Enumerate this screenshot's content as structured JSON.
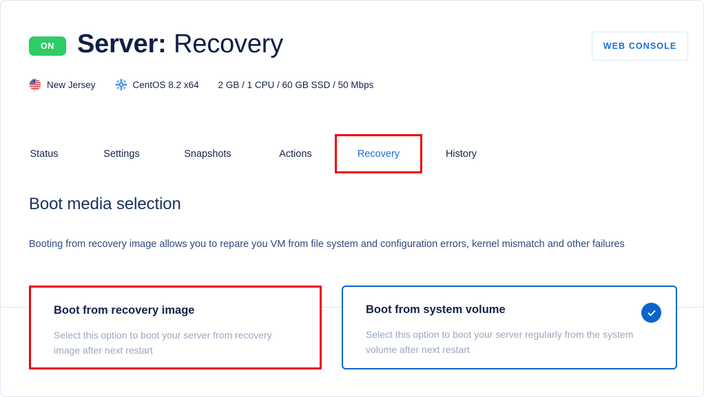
{
  "header": {
    "status_badge": "ON",
    "title_prefix": "Server:",
    "title_name": "Recovery",
    "web_console_label": "WEB CONSOLE",
    "meta": [
      {
        "icon": "us-flag-icon",
        "label": "New Jersey"
      },
      {
        "icon": "centos-logo-icon",
        "label": "CentOS 8.2 x64"
      },
      {
        "icon": "",
        "label": "2 GB / 1 CPU / 60 GB SSD / 50 Mbps"
      }
    ]
  },
  "tabs": [
    {
      "label": "Status",
      "active": false
    },
    {
      "label": "Settings",
      "active": false
    },
    {
      "label": "Snapshots",
      "active": false
    },
    {
      "label": "Actions",
      "active": false
    },
    {
      "label": "Recovery",
      "active": true
    },
    {
      "label": "History",
      "active": false
    }
  ],
  "main": {
    "section_title": "Boot media selection",
    "section_description": "Booting from recovery image allows you to repare you VM from file system and configuration errors, kernel mismatch and other failures",
    "options": [
      {
        "title": "Boot from recovery image",
        "description": "Select this option to boot your server from recovery image after next restart",
        "selected": false
      },
      {
        "title": "Boot from system volume",
        "description": "Select this option to boot your server regularly from the system volume after next restart",
        "selected": true
      }
    ]
  },
  "colors": {
    "status_on": "#2ecc66",
    "accent_blue": "#1a6dde",
    "selected_border": "#0b63ce",
    "annotation_red": "#ee0000",
    "title_navy": "#101f45",
    "muted_text": "#9aa7c0"
  }
}
